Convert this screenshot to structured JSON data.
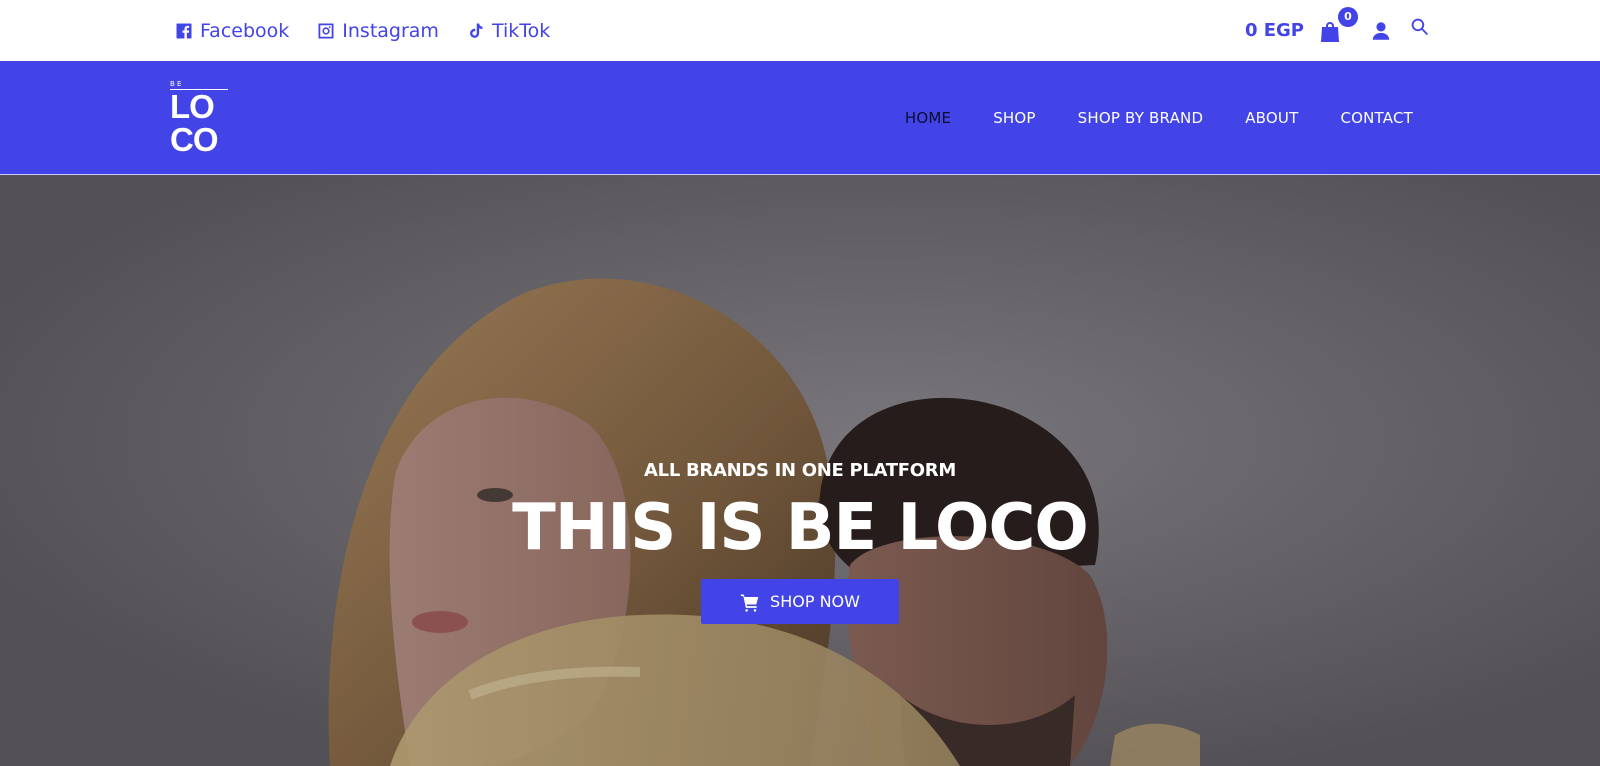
{
  "topbar": {
    "social": [
      {
        "label": "Facebook",
        "icon": "facebook-icon"
      },
      {
        "label": "Instagram",
        "icon": "instagram-icon"
      },
      {
        "label": "TikTok",
        "icon": "tiktok-icon"
      }
    ],
    "cart_total": "0 EGP",
    "cart_count": "0"
  },
  "logo": {
    "top": "B E",
    "line1": "LO",
    "line2": "CO"
  },
  "nav": {
    "items": [
      {
        "label": "HOME",
        "active": true
      },
      {
        "label": "SHOP"
      },
      {
        "label": "SHOP BY BRAND"
      },
      {
        "label": "ABOUT"
      },
      {
        "label": "CONTACT"
      }
    ]
  },
  "hero": {
    "eyebrow": "ALL BRANDS IN ONE PLATFORM",
    "headline": "THIS IS BE LOCO",
    "cta_label": "SHOP NOW"
  },
  "colors": {
    "brand": "#4244e8",
    "text_dark": "#0d0d2e",
    "white": "#ffffff"
  }
}
